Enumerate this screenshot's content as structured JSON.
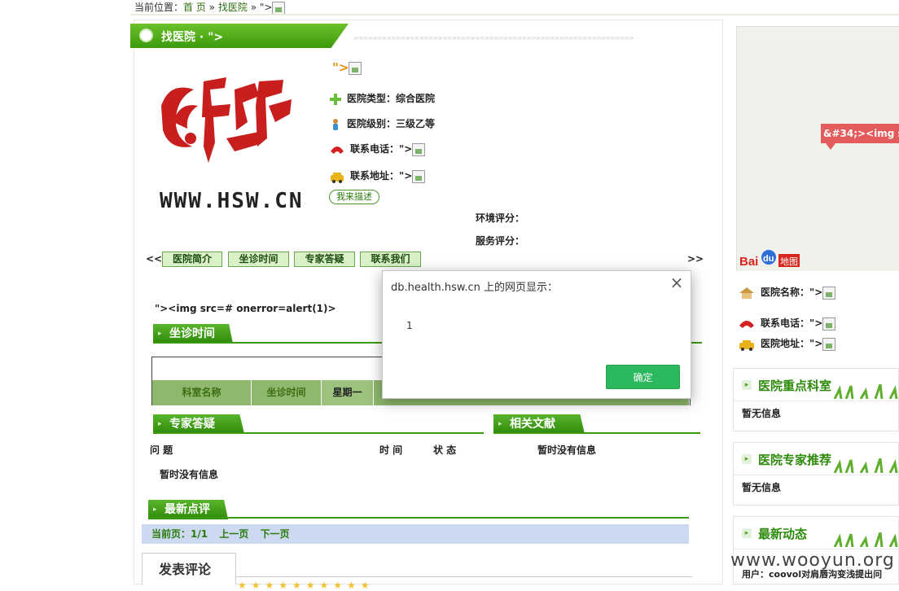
{
  "breadcrumb": {
    "prefix": "当前位置：",
    "home": "首 页",
    "sep": "»",
    "find": "找医院",
    "tail": "\">"
  },
  "section_title": "找医院 · \">",
  "hospital": {
    "name_fragment": "\">",
    "logo_url_text": "WWW.HSW.CN",
    "type_label": "医院类型：",
    "type_value": "综合医院",
    "level_label": "医院级别：",
    "level_value": "三级乙等",
    "phone_label": "联系电话：",
    "phone_value": "\">",
    "address_label": "联系地址：",
    "address_value": "\">",
    "describe_button": "我来描述",
    "env_score_label": "环境评分：",
    "service_score_label": "服务评分："
  },
  "tabs": {
    "prev": "<<",
    "next": ">>",
    "items": [
      "医院简介",
      "坐诊时间",
      "专家答疑",
      "联系我们"
    ]
  },
  "xss_text": "\"><img src=# onerror=alert(1)>",
  "schedule": {
    "title": "坐诊时间",
    "columns": [
      "科室名称",
      "坐诊时间",
      "星期一"
    ]
  },
  "qa": {
    "title": "专家答疑",
    "col_question": "问 题",
    "col_time": "时 间",
    "col_status": "状 态",
    "empty": "暂时没有信息"
  },
  "literature": {
    "title": "相关文献",
    "empty": "暂时没有信息"
  },
  "reviews": {
    "title": "最新点评",
    "current_page_label": "当前页：1/1",
    "prev_page": "上一页",
    "next_page": "下一页"
  },
  "comment_tab": "发表评论",
  "map": {
    "marker_text": "&#34;><img src=",
    "baidu": "Bai",
    "baidu_du": "du",
    "baidu_map": "地图"
  },
  "right_info": {
    "name_label": "医院名称：",
    "name_value": "\">",
    "phone_label": "联系电话：",
    "phone_value": "\">",
    "address_label": "医院地址：",
    "address_value": "\">"
  },
  "side_boxes": {
    "key_dept": {
      "title": "医院重点科室",
      "body": "暂无信息"
    },
    "experts": {
      "title": "医院专家推荐",
      "body": "暂无信息"
    },
    "news": {
      "title": "最新动态",
      "body": "用户：coovol对肩唇沟变浅提出问"
    }
  },
  "watermark": "www.wooyun.org",
  "dialog": {
    "title": "db.health.hsw.cn 上的网页显示：",
    "message": "1",
    "ok_button": "确定",
    "close_icon": "×"
  }
}
